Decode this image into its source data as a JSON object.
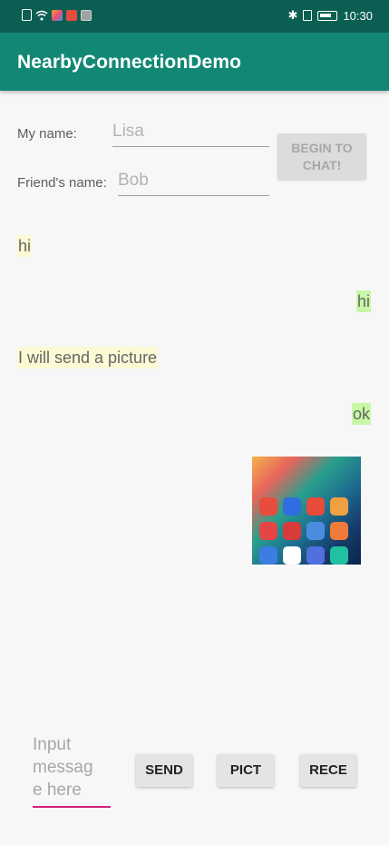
{
  "status_bar": {
    "time": "10:30",
    "left_icons": [
      "sim-card-icon",
      "wifi-icon",
      "app-notification-icon",
      "app-notification-icon",
      "app-notification-icon"
    ],
    "right_icons": [
      "bluetooth-icon",
      "vibrate-icon",
      "battery-icon"
    ]
  },
  "app_bar": {
    "title": "NearbyConnectionDemo",
    "color": "#128874"
  },
  "form": {
    "my_name_label": "My name:",
    "my_name_value": "Lisa",
    "friend_name_label": "Friend's name:",
    "friend_name_value": "Bob",
    "begin_button_label": "BEGIN TO CHAT!"
  },
  "messages": [
    {
      "text": "hi",
      "direction": "incoming"
    },
    {
      "text": "hi",
      "direction": "outgoing"
    },
    {
      "text": "I will send a picture",
      "direction": "incoming"
    },
    {
      "text": "ok",
      "direction": "outgoing"
    }
  ],
  "picture_message": {
    "description": "phone home screen screenshot",
    "app_tile_colors": [
      "#e74c3c",
      "#2f6ee0",
      "#e84a3c",
      "#f0a040",
      "#e64545",
      "#d93a3a",
      "#4a8de0",
      "#f07a3a",
      "#3b7de0",
      "#ffffff",
      "#5070e0",
      "#20c0a0"
    ]
  },
  "composer": {
    "input_placeholder": "Input\nmessag\ne here",
    "send_label": "SEND",
    "picture_label": "PICT",
    "receive_label": "RECE",
    "accent": "#d21f7a"
  }
}
